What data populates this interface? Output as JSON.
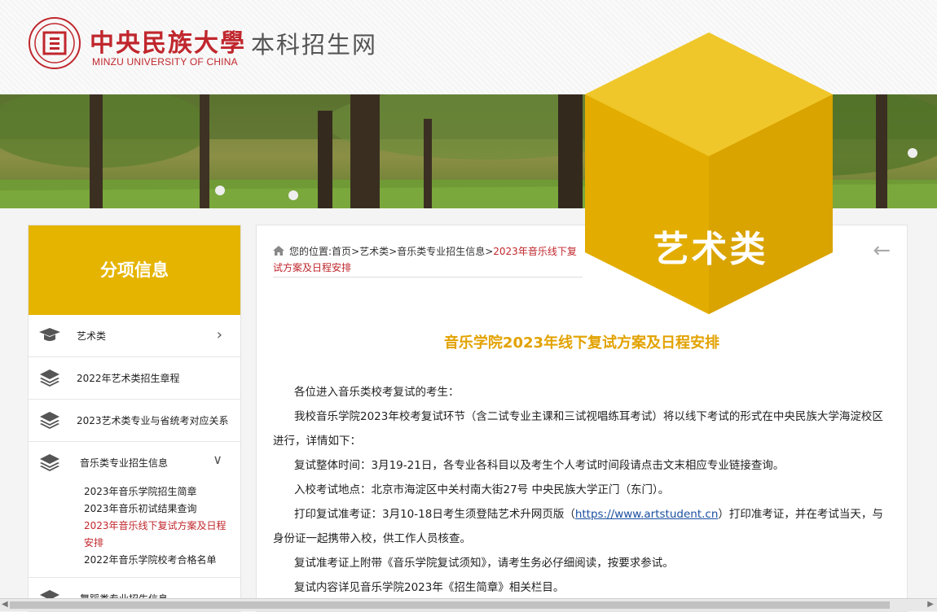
{
  "header": {
    "logo_cn": "中央民族大學",
    "logo_en": "MINZU UNIVERSITY OF CHINA",
    "site_title": "本科招生网"
  },
  "badge": {
    "label": "艺术类"
  },
  "sidebar": {
    "heading": "分项信息",
    "items": [
      {
        "label": "艺术类",
        "icon": "graduation-cap-icon"
      },
      {
        "label": "2022年艺术类招生章程",
        "icon": "layers-icon"
      },
      {
        "label": "2023艺术类专业与省统考对应关系",
        "icon": "layers-icon"
      },
      {
        "label": "音乐类专业招生信息",
        "icon": "layers-icon"
      }
    ],
    "subitems": [
      "2023年音乐学院招生简章",
      "2023年音乐初试结果查询",
      "2023年音乐线下复试方案及日程安排",
      "2022年音乐学院校考合格名单"
    ],
    "next_item": "舞蹈类专业招生信息"
  },
  "breadcrumb": {
    "prefix": "您的位置:",
    "links": [
      "首页",
      "艺术类",
      "音乐类专业招生信息"
    ],
    "separator": ">",
    "current": "2023年音乐线下复试方案及日程安排"
  },
  "article": {
    "title": "音乐学院2023年线下复试方案及日程安排",
    "paragraphs": [
      "各位进入音乐类校考复试的考生：",
      "我校音乐学院2023年校考复试环节（含二试专业主课和三试视唱练耳考试）将以线下考试的形式在中央民族大学海淀校区进行，详情如下：",
      "复试整体时间：3月19-21日，各专业各科目以及考生个人考试时间段请点击文末相应专业链接查询。",
      "入校考试地点：北京市海淀区中关村南大街27号  中央民族大学正门（东门）。"
    ],
    "print_before": "打印复试准考证：3月10-18日考生须登陆艺术升网页版（",
    "print_link": "https://www.artstudent.cn",
    "print_after": "）打印准考证，并在考试当天，与身份证一起携带入校，供工作人员核查。",
    "paragraphs2": [
      "复试准考证上附带《音乐学院复试须知》，请考生务必仔细阅读，按要求参试。",
      "复试内容详见音乐学院2023年《招生简章》相关栏目。"
    ]
  },
  "colors": {
    "accent": "#e5b400",
    "brand_red": "#c0272d",
    "title_gold": "#e2a200"
  }
}
